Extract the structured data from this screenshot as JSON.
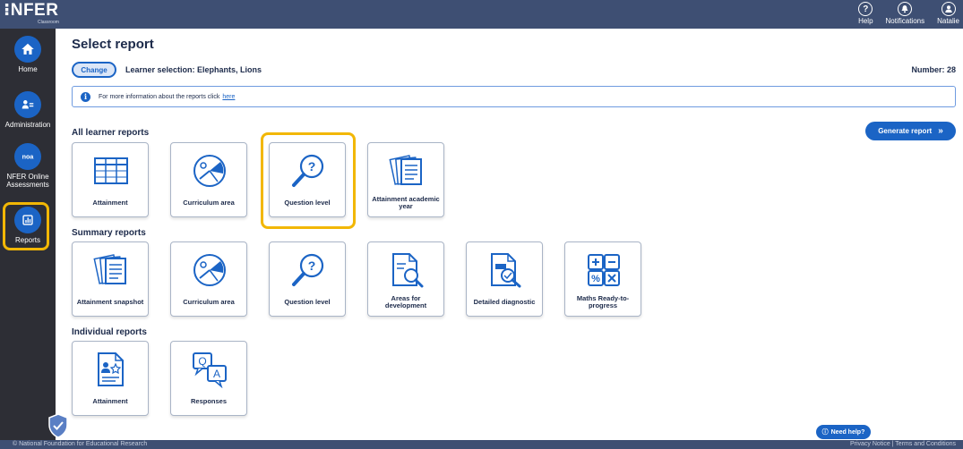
{
  "header": {
    "logo": "NFER",
    "logo_sub": "Classroom",
    "help": "Help",
    "notifications": "Notifications",
    "user": "Natalie"
  },
  "sidebar": {
    "home": "Home",
    "administration": "Administration",
    "online": "NFER Online Assessments",
    "reports": "Reports"
  },
  "main": {
    "title": "Select report",
    "change": "Change",
    "learner_selection": "Learner selection: Elephants, Lions",
    "number": "Number: 28",
    "info_text": "For more information about the reports click",
    "info_link": "here",
    "generate": "Generate report",
    "generate_icon": "»",
    "need_help": "Need help?",
    "sections": [
      {
        "title": "All learner reports",
        "cards": [
          "Attainment",
          "Curriculum area",
          "Question level",
          "Attainment academic year"
        ]
      },
      {
        "title": "Summary reports",
        "cards": [
          "Attainment snapshot",
          "Curriculum area",
          "Question level",
          "Areas for development",
          "Detailed diagnostic",
          "Maths Ready-to-progress"
        ]
      },
      {
        "title": "Individual reports",
        "cards": [
          "Attainment",
          "Responses"
        ]
      }
    ]
  },
  "footer": {
    "left": "© National Foundation for Educational Research",
    "right": "Privacy Notice | Terms and Conditions"
  },
  "colors": {
    "accent": "#1b64c5",
    "highlight": "#f2b705",
    "header": "#3e4f73",
    "sidebar": "#2d2e35"
  }
}
